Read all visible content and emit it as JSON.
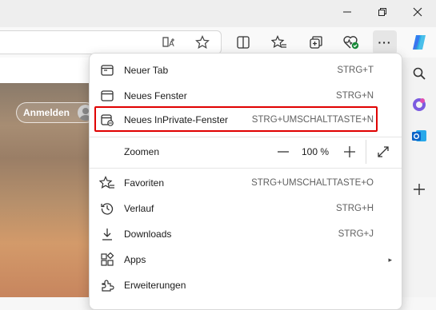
{
  "menu": {
    "items": [
      {
        "label": "Neuer Tab",
        "shortcut": "STRG+T"
      },
      {
        "label": "Neues Fenster",
        "shortcut": "STRG+N"
      },
      {
        "label": "Neues InPrivate-Fenster",
        "shortcut": "STRG+UMSCHALTTASTE+N"
      },
      {
        "label": "Zoomen",
        "zoom_value": "100 %"
      },
      {
        "label": "Favoriten",
        "shortcut": "STRG+UMSCHALTTASTE+O"
      },
      {
        "label": "Verlauf",
        "shortcut": "STRG+H"
      },
      {
        "label": "Downloads",
        "shortcut": "STRG+J"
      },
      {
        "label": "Apps",
        "submenu_arrow": "▸"
      },
      {
        "label": "Erweiterungen"
      }
    ]
  },
  "content": {
    "signin_label": "Anmelden"
  },
  "toolbar": {
    "more_label": "···"
  },
  "colors": {
    "highlight": "#e00000",
    "accent": "#0078d4"
  },
  "icons": {
    "toolbar": [
      "reader-view-icon",
      "favorite-star-icon",
      "split-screen-icon",
      "favorites-icon",
      "collections-icon",
      "browser-essentials-icon",
      "more-icon",
      "copilot-icon"
    ],
    "sidebar": [
      "search-icon",
      "shopping-icon",
      "outlook-icon",
      "add-icon"
    ]
  }
}
